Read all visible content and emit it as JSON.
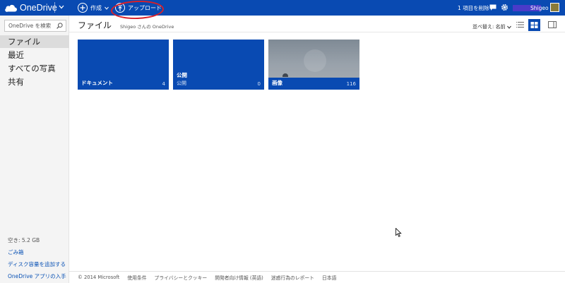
{
  "topbar": {
    "app_name": "OneDrive",
    "create_label": "作成",
    "upload_label": "アップロード",
    "delete_label": "1 項目を削除",
    "user_name": "Shigeo"
  },
  "sidebar": {
    "search_placeholder": "OneDrive を検索",
    "items": [
      {
        "label": "ファイル"
      },
      {
        "label": "最近"
      },
      {
        "label": "すべての写真"
      },
      {
        "label": "共有"
      }
    ],
    "storage": "空き: 5.2 GB",
    "links": [
      {
        "label": "ごみ箱"
      },
      {
        "label": "ディスク容量を追加する"
      },
      {
        "label": "OneDrive アプリの入手"
      }
    ]
  },
  "main": {
    "title": "ファイル",
    "subtitle": "Shigeo さんの OneDrive",
    "sort_label": "並べ替え: 名前",
    "tiles": [
      {
        "name": "ドキュメント",
        "sub": "",
        "count": "4"
      },
      {
        "name": "公開",
        "sub": "公開",
        "count": "0"
      },
      {
        "name": "画像",
        "sub": "",
        "count": "116"
      }
    ]
  },
  "footer": {
    "items": [
      "© 2014 Microsoft",
      "使用条件",
      "プライバシーとクッキー",
      "開発者向け情報 (英語)",
      "迷惑行為のレポート",
      "日本語"
    ]
  },
  "colors": {
    "brand": "#094ab2",
    "link": "#0a52b5",
    "highlight_ring": "#d8202a"
  }
}
